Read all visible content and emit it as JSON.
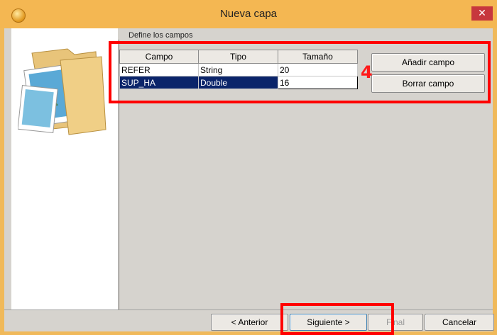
{
  "window": {
    "title": "Nueva capa",
    "close_glyph": "✕"
  },
  "left_panel": {
    "image": "folder-with-pictures-icon"
  },
  "fields_section": {
    "label": "Define los campos"
  },
  "table": {
    "columns": [
      "Campo",
      "Tipo",
      "Tamaño"
    ],
    "rows": [
      {
        "campo": "REFER",
        "tipo": "String",
        "tamano": "20"
      },
      {
        "campo": "SUP_HA",
        "tipo": "Double",
        "tamano": "16"
      }
    ],
    "selected_row": 1
  },
  "side_buttons": {
    "add": "Añadir campo",
    "remove": "Borrar campo"
  },
  "nav_buttons": {
    "prev": "< Anterior",
    "next": "Siguiente >",
    "finish": "Final",
    "cancel": "Cancelar"
  },
  "annotation": {
    "step_number": "4",
    "color": "#ff0000"
  },
  "colors": {
    "title_bar": "#f4b752",
    "selection": "#0a246a",
    "close": "#c7373d"
  }
}
